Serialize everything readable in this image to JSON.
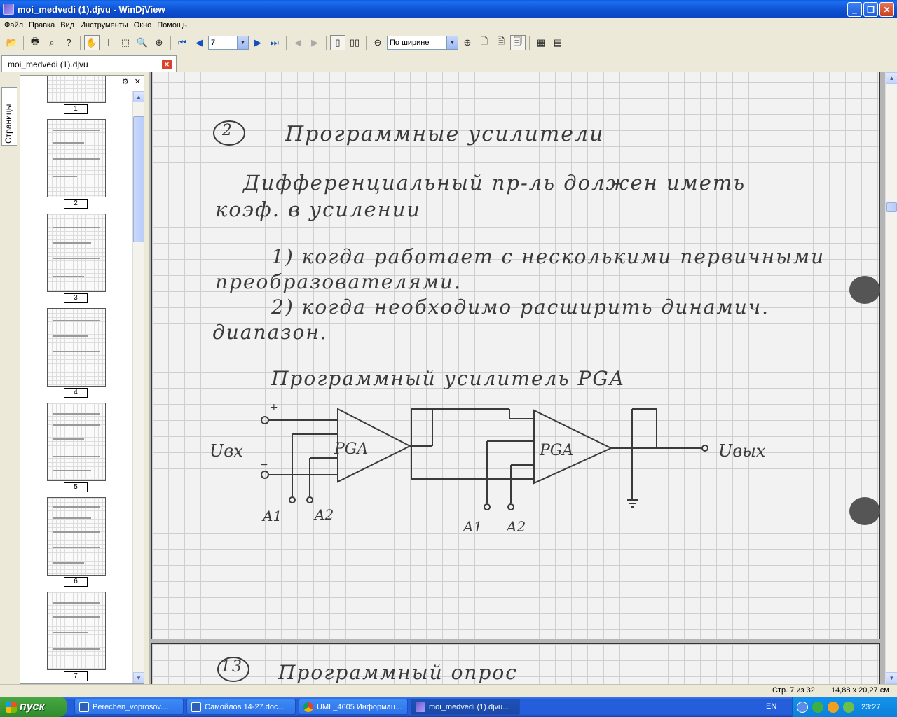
{
  "window": {
    "title": "moi_medvedi (1).djvu - WinDjView",
    "minimize": "_",
    "maximize": "❐",
    "close": "✕"
  },
  "menu": [
    "Файл",
    "Правка",
    "Вид",
    "Инструменты",
    "Окно",
    "Помощь"
  ],
  "toolbar": {
    "page_value": "7",
    "zoom_value": "По ширине"
  },
  "tab": {
    "label": "moi_medvedi (1).djvu"
  },
  "sidebar": {
    "tab_label": "Страницы",
    "pages": [
      "1",
      "2",
      "3",
      "4",
      "5",
      "6",
      "7"
    ]
  },
  "page": {
    "heading_num": "2",
    "heading": "Программные усилители",
    "line1": "Дифференциальный пр-ль должен иметь",
    "line2": "коэф. в усилении",
    "line3": "1) когда работает с несколькими первичными",
    "line4": "преобразователями.",
    "line5": "2) когда необходимо расширить динамич.",
    "line6": "диапазон.",
    "diagram_title": "Программный усилитель PGA",
    "label_in": "Uвх",
    "label_out": "Uвых",
    "amp1": "PGA",
    "amp2": "PGA",
    "plus": "+",
    "minus": "−",
    "a1_left": "A1",
    "a2_left": "A2",
    "a1_right": "A1",
    "a2_right": "A2",
    "next_num": "13",
    "next_heading": "Программный опрос"
  },
  "status": {
    "page_info": "Стр. 7 из 32",
    "page_size": "14,88 x 20,27 см"
  },
  "taskbar": {
    "start": "пуск",
    "tasks": [
      "Perechen_voprosov....",
      "Самойлов 14-27.doc...",
      "UML_4605 Информац...",
      "moi_medvedi (1).djvu..."
    ],
    "lang": "EN",
    "clock": "23:27"
  }
}
